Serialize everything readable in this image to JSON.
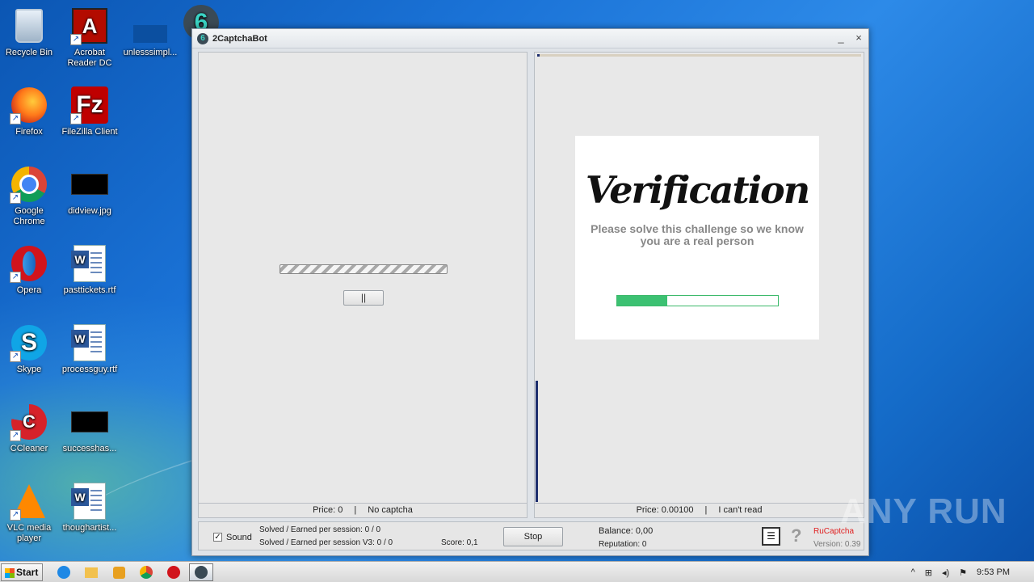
{
  "desktop": {
    "icons": [
      {
        "label": "Recycle Bin",
        "icon": "recycle-bin-icon"
      },
      {
        "label": "Acrobat Reader DC",
        "icon": "acrobat-icon"
      },
      {
        "label": "unlesssimpl...",
        "icon": "file-icon"
      },
      {
        "label": "Firefox",
        "icon": "firefox-icon"
      },
      {
        "label": "FileZilla Client",
        "icon": "filezilla-icon"
      },
      {
        "label": "Google Chrome",
        "icon": "chrome-icon"
      },
      {
        "label": "didview.jpg",
        "icon": "image-file-icon"
      },
      {
        "label": "Opera",
        "icon": "opera-icon"
      },
      {
        "label": "pasttickets.rtf",
        "icon": "word-doc-icon"
      },
      {
        "label": "Skype",
        "icon": "skype-icon"
      },
      {
        "label": "processguy.rtf",
        "icon": "word-doc-icon"
      },
      {
        "label": "CCleaner",
        "icon": "ccleaner-icon"
      },
      {
        "label": "successhas...",
        "icon": "image-file-icon"
      },
      {
        "label": "VLC media player",
        "icon": "vlc-icon"
      },
      {
        "label": "thoughartist...",
        "icon": "word-doc-icon"
      }
    ]
  },
  "window": {
    "title": "2CaptchaBot",
    "minimize_glyph": "_",
    "close_glyph": "×",
    "left_pane": {
      "pause_label": "||",
      "status": {
        "price": "Price: 0",
        "separator": "|",
        "message": "No captcha"
      }
    },
    "right_pane": {
      "captcha_title": "Verification",
      "captcha_message": "Please solve this challenge so we know you are a real person",
      "progress_fraction": 0.31,
      "status": {
        "price": "Price: 0.00100",
        "separator": "|",
        "message": "I can't read"
      }
    },
    "bottom": {
      "sound_label": "Sound",
      "sound_checked": "✓",
      "solved_session": "Solved / Earned per session: 0 / 0",
      "solved_session_v3": "Solved / Earned per session V3: 0 / 0",
      "score": "Score: 0,1",
      "stop_label": "Stop",
      "balance": "Balance:  0,00",
      "reputation": "Reputation: 0",
      "help_glyph": "?",
      "service": "RuCaptcha",
      "version": "Version: 0.39",
      "service_color": "#e02020"
    }
  },
  "watermark": "ANY RUN",
  "taskbar": {
    "start_label": "Start",
    "clock": "9:53 PM",
    "tray_glyphs": [
      "^",
      "⊞",
      "◂)",
      "⚑"
    ]
  }
}
